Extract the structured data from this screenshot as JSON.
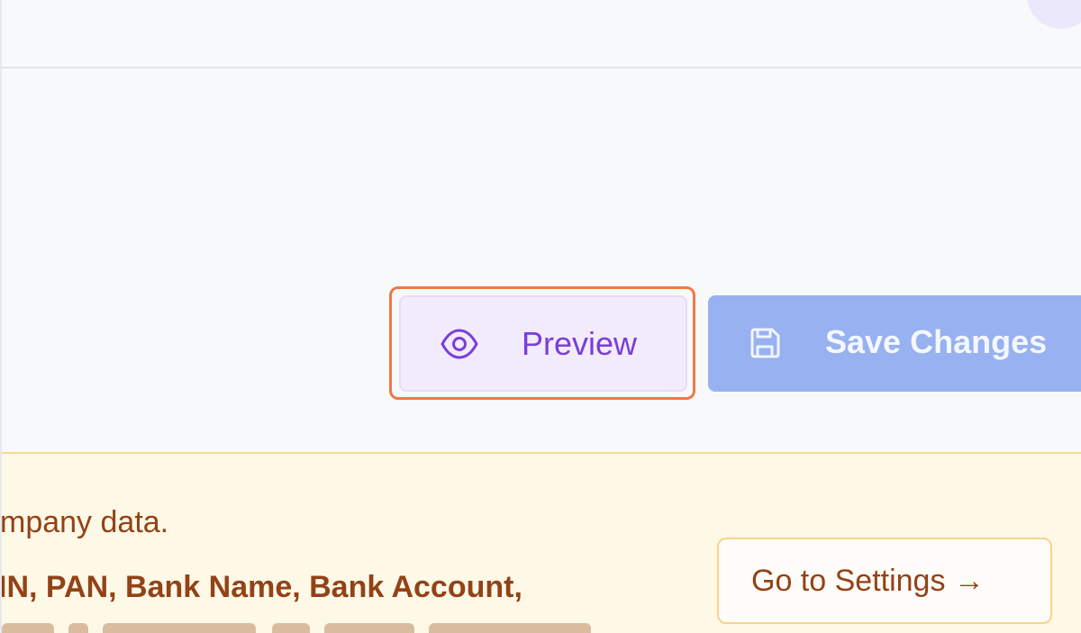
{
  "actions": {
    "preview_label": "Preview",
    "save_label": "Save Changes"
  },
  "warning": {
    "line1": "mpany data.",
    "line2": "IN, PAN, Bank Name, Bank Account,",
    "settings_button_label": "Go to Settings →"
  },
  "colors": {
    "accent_purple": "#7a3ed9",
    "focus_ring": "#ef7847",
    "save_button_bg": "#97b1f1",
    "warning_text": "#934217",
    "warning_bg": "#fef9e7"
  },
  "icons": {
    "preview": "eye-icon",
    "save": "floppy-disk-icon"
  }
}
